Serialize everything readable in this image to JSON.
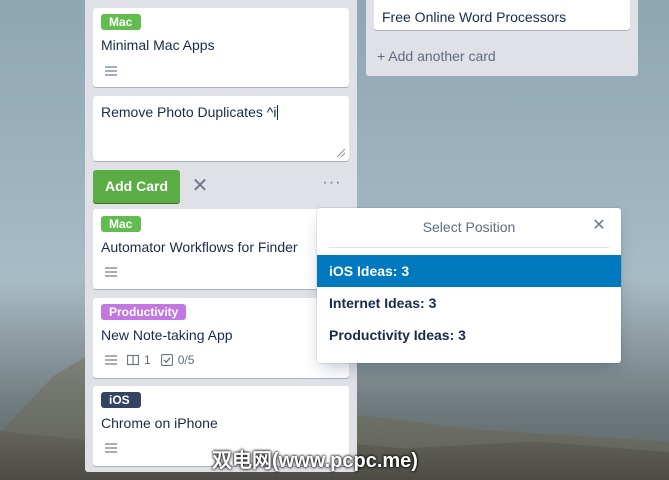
{
  "board": {
    "left_list": {
      "cards_top": [
        {
          "label": "Mac",
          "label_color": "#61bd4f",
          "title": "Minimal Mac Apps",
          "has_description": true
        }
      ],
      "composer": {
        "value": "Remove Photo Duplicates ^i"
      },
      "add_card_label": "Add Card",
      "cancel_icon": "close-icon",
      "more_icon": "more-icon",
      "cards_bottom": [
        {
          "label": "Mac",
          "label_color": "#61bd4f",
          "title": "Automator Workflows for Finder",
          "has_description": true
        },
        {
          "label": "Productivity",
          "label_color": "#c377e0",
          "title": "New Note-taking App",
          "has_description": true,
          "attachments": "1",
          "checklist": "0/5"
        },
        {
          "label": "iOS",
          "label_color": "#344563",
          "title": "Chrome on iPhone",
          "has_description": true
        }
      ]
    },
    "right_list": {
      "cards": [
        {
          "label_color": "#00c2e0",
          "title": "Free Online Word Processors"
        }
      ],
      "add_another_label": "+ Add another card"
    }
  },
  "select_position_popover": {
    "title": "Select Position",
    "options": [
      {
        "label": "iOS Ideas: 3",
        "selected": true
      },
      {
        "label": "Internet Ideas: 3",
        "selected": false
      },
      {
        "label": "Productivity Ideas: 3",
        "selected": false
      }
    ]
  },
  "watermark": "双电网(www.pcpc.me)",
  "colors": {
    "primary_button": "#5aac44",
    "selected_option": "#0079bf",
    "list_background": "#dfe1e6"
  }
}
